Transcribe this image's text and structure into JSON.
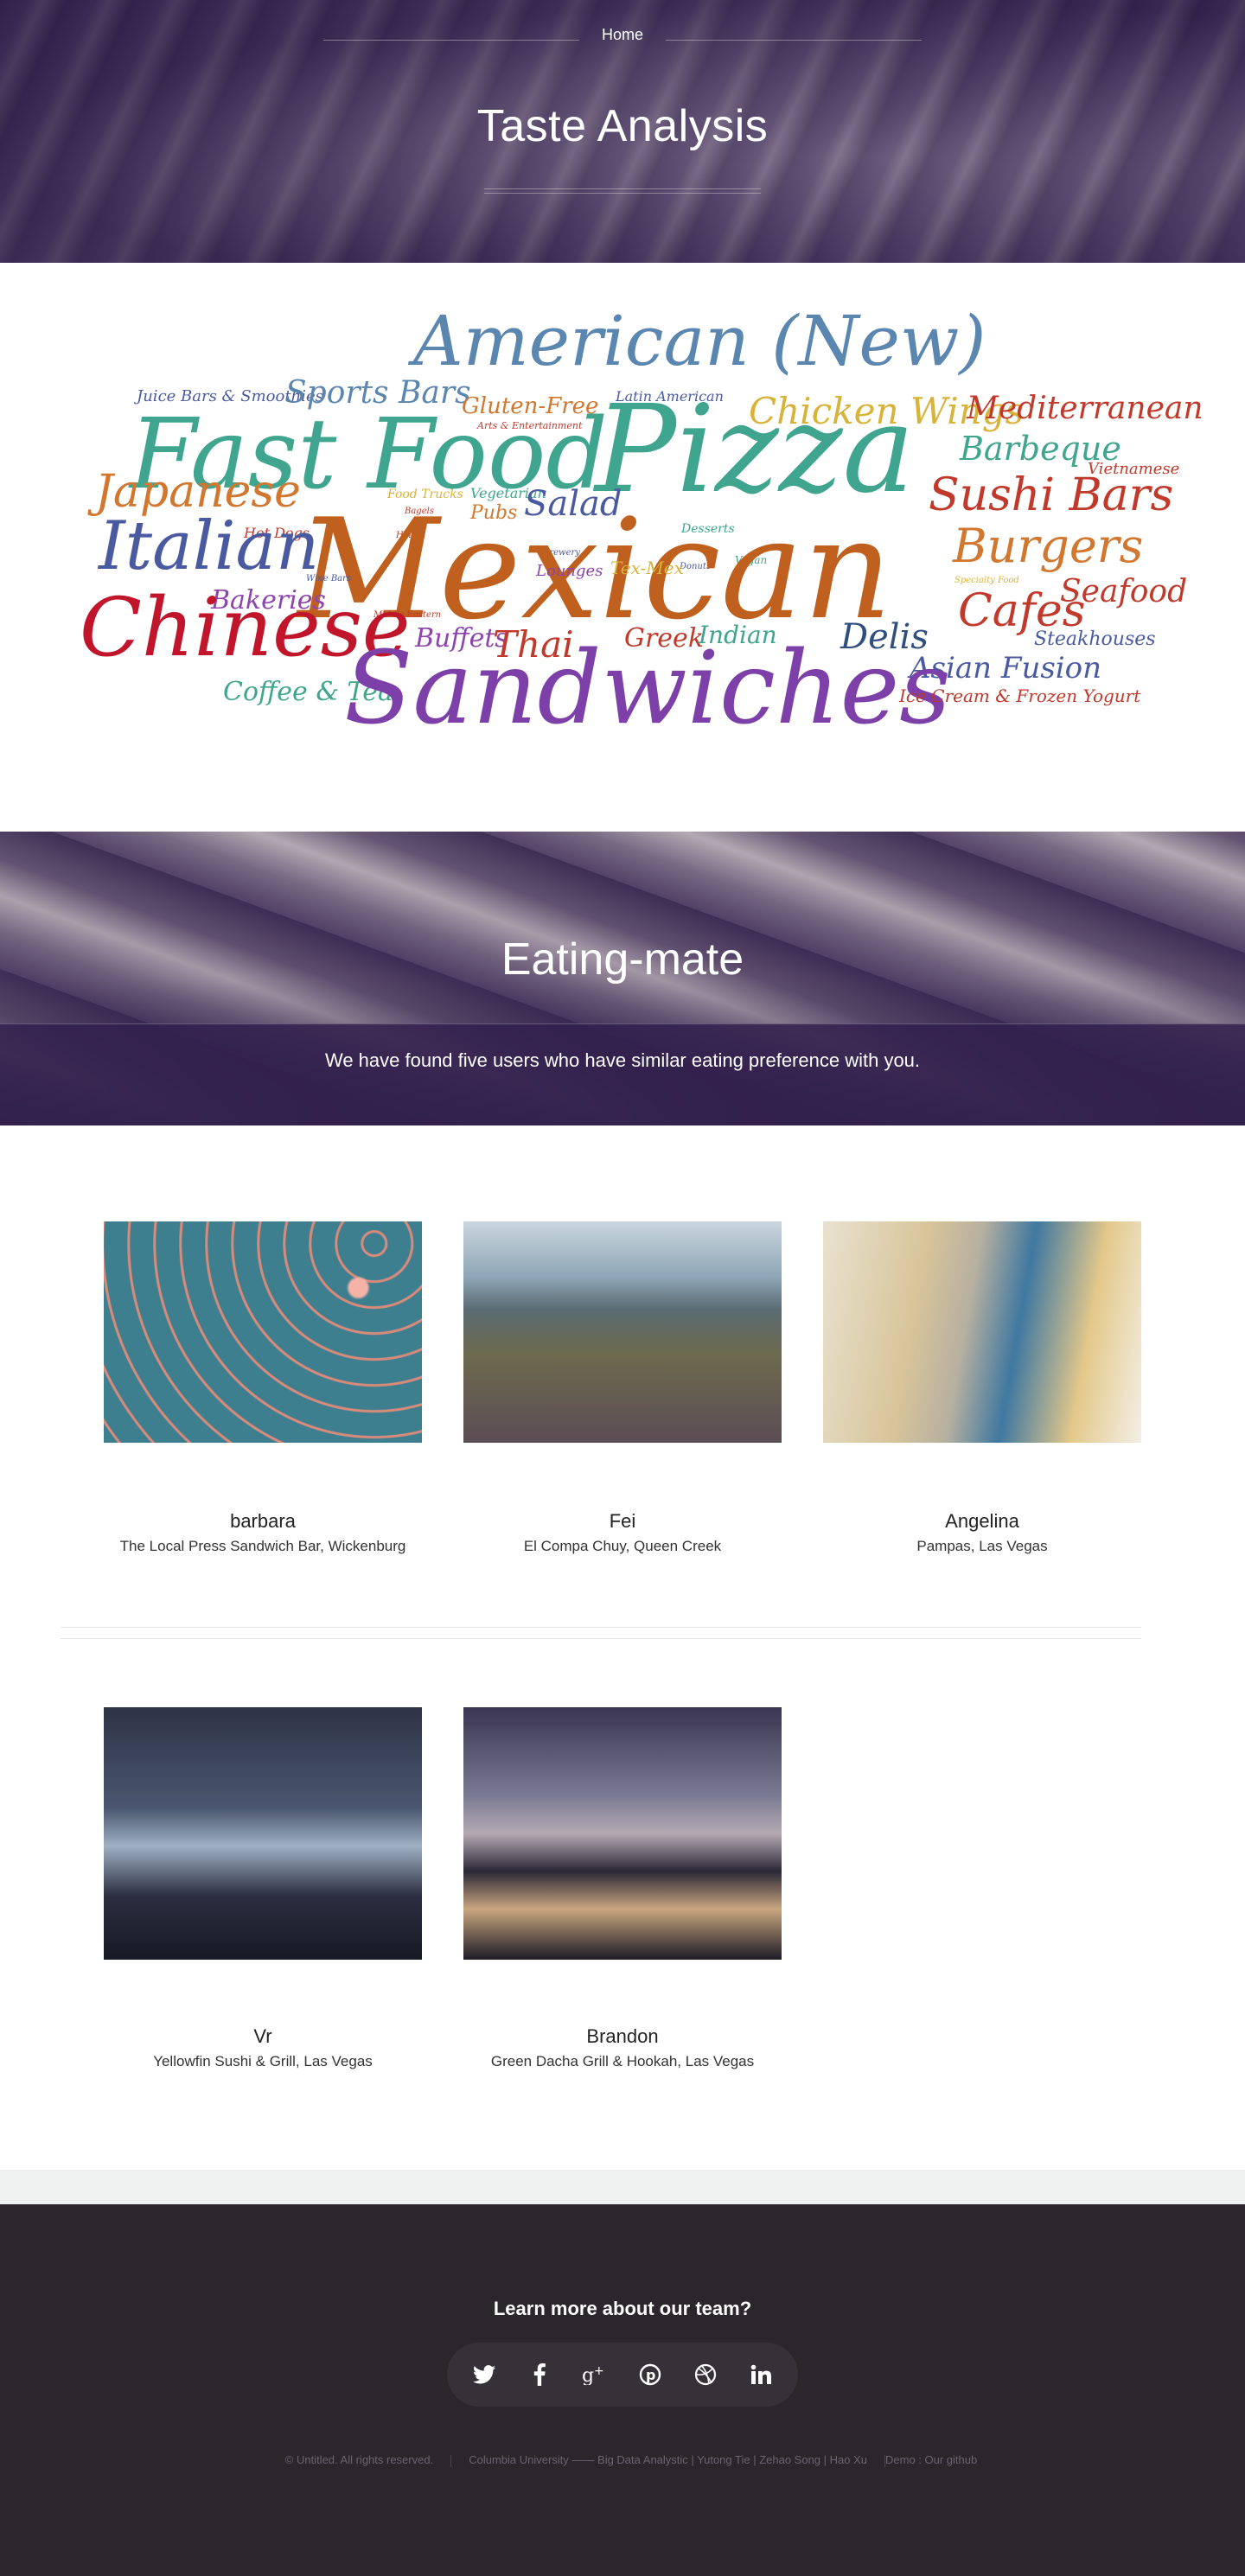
{
  "hero": {
    "nav_home": "Home",
    "title": "Taste Analysis"
  },
  "word_cloud": [
    {
      "text": "American (New)",
      "color": "#5a86b0"
    },
    {
      "text": "Juice Bars & Smoothies",
      "color": "#4a5aa0"
    },
    {
      "text": "Sports Bars",
      "color": "#5a86b0"
    },
    {
      "text": "Gluten-Free",
      "color": "#d2772f"
    },
    {
      "text": "Arts & Entertainment",
      "color": "#c0392b"
    },
    {
      "text": "Latin American",
      "color": "#4a5aa0"
    },
    {
      "text": "Chicken Wings",
      "color": "#d8b33a"
    },
    {
      "text": "Mediterranean",
      "color": "#c0392b"
    },
    {
      "text": "Fast Food",
      "color": "#3fa58e"
    },
    {
      "text": "Pizza",
      "color": "#3fa58e"
    },
    {
      "text": "Barbeque",
      "color": "#3fa58e"
    },
    {
      "text": "Vietnamese",
      "color": "#c0392b"
    },
    {
      "text": "Japanese",
      "color": "#d2772f"
    },
    {
      "text": "Food Trucks",
      "color": "#d8b33a"
    },
    {
      "text": "Vegetarian",
      "color": "#3fa58e"
    },
    {
      "text": "Salad",
      "color": "#4a5aa0"
    },
    {
      "text": "Sushi Bars",
      "color": "#c0392b"
    },
    {
      "text": "Bagels",
      "color": "#c0392b"
    },
    {
      "text": "Pubs",
      "color": "#d2772f"
    },
    {
      "text": "Desserts",
      "color": "#3fa58e"
    },
    {
      "text": "Hot Dogs",
      "color": "#c0392b"
    },
    {
      "text": "Burgers",
      "color": "#d2772f"
    },
    {
      "text": "Italian",
      "color": "#4a5aa0"
    },
    {
      "text": "Halal",
      "color": "#c0392b"
    },
    {
      "text": "Brewery",
      "color": "#4a5aa0"
    },
    {
      "text": "Vegan",
      "color": "#3fa58e"
    },
    {
      "text": "Donuts",
      "color": "#4a5aa0"
    },
    {
      "text": "Mexican",
      "color": "#c0601f"
    },
    {
      "text": "Lounges",
      "color": "#8e44ad"
    },
    {
      "text": "Tex-Mex",
      "color": "#d8b33a"
    },
    {
      "text": "Seafood",
      "color": "#c0392b"
    },
    {
      "text": "Specialty Food",
      "color": "#d8b33a"
    },
    {
      "text": "Wine Bars",
      "color": "#4a5aa0"
    },
    {
      "text": "Bakeries",
      "color": "#8e44ad"
    },
    {
      "text": "Middle Eastern",
      "color": "#c0392b"
    },
    {
      "text": "Cafes",
      "color": "#c0392b"
    },
    {
      "text": "Chinese",
      "color": "#c0152b"
    },
    {
      "text": "Buffets",
      "color": "#8e44ad"
    },
    {
      "text": "Thai",
      "color": "#c0392b"
    },
    {
      "text": "Greek",
      "color": "#c0392b"
    },
    {
      "text": "Indian",
      "color": "#3fa58e"
    },
    {
      "text": "Delis",
      "color": "#2f4f7f"
    },
    {
      "text": "Steakhouses",
      "color": "#4a5aa0"
    },
    {
      "text": "Asian Fusion",
      "color": "#4a5aa0"
    },
    {
      "text": "Coffee & Tea",
      "color": "#3fa58e"
    },
    {
      "text": "Sandwiches",
      "color": "#7d3fa8"
    },
    {
      "text": "Ice Cream & Frozen Yogurt",
      "color": "#c0392b"
    }
  ],
  "eating_mate": {
    "title": "Eating-mate",
    "subtitle": "We have found five users who have similar eating preference with you."
  },
  "users": [
    {
      "name": "barbara",
      "place": "The Local Press Sandwich Bar, Wickenburg"
    },
    {
      "name": "Fei",
      "place": "El Compa Chuy, Queen Creek"
    },
    {
      "name": "Angelina",
      "place": "Pampas, Las Vegas"
    },
    {
      "name": "Vr",
      "place": "Yellowfin Sushi & Grill, Las Vegas"
    },
    {
      "name": "Brandon",
      "place": "Green Dacha Grill & Hookah, Las Vegas"
    }
  ],
  "footer": {
    "heading": "Learn more about our team?",
    "social_icons": [
      "twitter-icon",
      "facebook-icon",
      "google-plus-icon",
      "pinterest-icon",
      "dribbble-icon",
      "linkedin-icon"
    ],
    "copyright": "© Untitled. All rights reserved.",
    "credits": "Columbia University —— Big Data Analystic | Yutong Tie | Zehao Song | Hao Xu",
    "demo": "Demo : Our github"
  }
}
